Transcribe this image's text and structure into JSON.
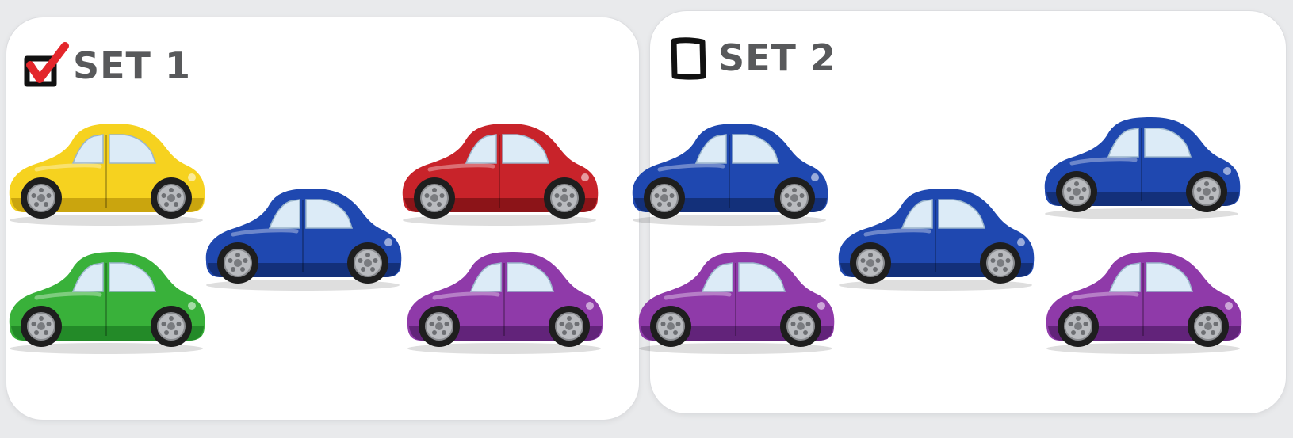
{
  "sets": [
    {
      "label": "SET 1",
      "checked": true,
      "checkbox_icon": "checked-box-icon",
      "check_color": "#e3262b",
      "cars": [
        {
          "color": "yellow",
          "body": "#f6d21f",
          "shade": "#caa50e"
        },
        {
          "color": "green",
          "body": "#39b13a",
          "shade": "#238a28"
        },
        {
          "color": "blue",
          "body": "#1f48b0",
          "shade": "#13307a"
        },
        {
          "color": "red",
          "body": "#c8232a",
          "shade": "#8c1418"
        },
        {
          "color": "purple",
          "body": "#8f3aa9",
          "shade": "#62237a"
        }
      ]
    },
    {
      "label": "SET 2",
      "checked": false,
      "checkbox_icon": "empty-box-icon",
      "cars": [
        {
          "color": "blue",
          "body": "#1f48b0",
          "shade": "#13307a"
        },
        {
          "color": "purple",
          "body": "#8f3aa9",
          "shade": "#62237a"
        },
        {
          "color": "blue",
          "body": "#1f48b0",
          "shade": "#13307a"
        },
        {
          "color": "blue",
          "body": "#1f48b0",
          "shade": "#13307a"
        },
        {
          "color": "purple",
          "body": "#8f3aa9",
          "shade": "#62237a"
        }
      ]
    }
  ]
}
